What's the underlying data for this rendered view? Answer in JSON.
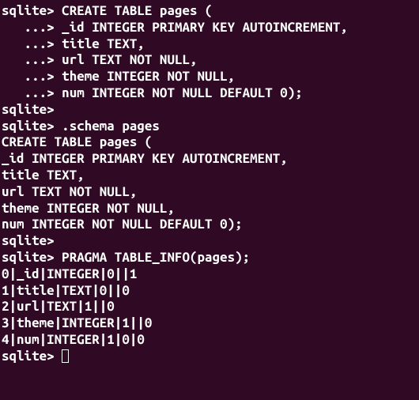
{
  "prompt": "sqlite> ",
  "continuation": "   ...> ",
  "lines": [
    {
      "prefix": "prompt",
      "text": "CREATE TABLE pages ("
    },
    {
      "prefix": "continuation",
      "text": "_id INTEGER PRIMARY KEY AUTOINCREMENT,"
    },
    {
      "prefix": "continuation",
      "text": "title TEXT,"
    },
    {
      "prefix": "continuation",
      "text": "url TEXT NOT NULL,"
    },
    {
      "prefix": "continuation",
      "text": "theme INTEGER NOT NULL,"
    },
    {
      "prefix": "continuation",
      "text": "num INTEGER NOT NULL DEFAULT 0);"
    },
    {
      "prefix": "prompt",
      "text": ""
    },
    {
      "prefix": "prompt",
      "text": ".schema pages"
    },
    {
      "prefix": null,
      "text": "CREATE TABLE pages ("
    },
    {
      "prefix": null,
      "text": "_id INTEGER PRIMARY KEY AUTOINCREMENT,"
    },
    {
      "prefix": null,
      "text": "title TEXT,"
    },
    {
      "prefix": null,
      "text": "url TEXT NOT NULL,"
    },
    {
      "prefix": null,
      "text": "theme INTEGER NOT NULL,"
    },
    {
      "prefix": null,
      "text": "num INTEGER NOT NULL DEFAULT 0);"
    },
    {
      "prefix": "prompt",
      "text": ""
    },
    {
      "prefix": "prompt",
      "text": "PRAGMA TABLE_INFO(pages);"
    },
    {
      "prefix": null,
      "text": "0|_id|INTEGER|0||1"
    },
    {
      "prefix": null,
      "text": "1|title|TEXT|0||0"
    },
    {
      "prefix": null,
      "text": "2|url|TEXT|1||0"
    },
    {
      "prefix": null,
      "text": "3|theme|INTEGER|1||0"
    },
    {
      "prefix": null,
      "text": "4|num|INTEGER|1|0|0"
    }
  ],
  "cursor_line_prefix": "prompt"
}
